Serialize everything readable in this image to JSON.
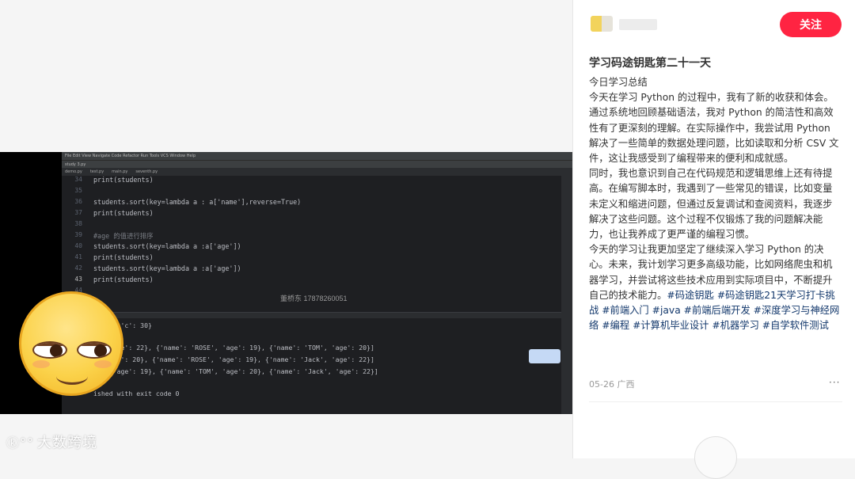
{
  "author": {
    "follow_label": "关注"
  },
  "post": {
    "title": "学习码途钥匙第二十一天",
    "paragraphs": [
      "今日学习总结",
      "今天在学习 Python 的过程中，我有了新的收获和体会。通过系统地回顾基础语法，我对 Python 的简洁性和高效性有了更深刻的理解。在实际操作中，我尝试用 Python 解决了一些简单的数据处理问题，比如读取和分析 CSV 文件，这让我感受到了编程带来的便利和成就感。",
      "同时，我也意识到自己在代码规范和逻辑思维上还有待提高。在编写脚本时，我遇到了一些常见的错误，比如变量未定义和缩进问题，但通过反复调试和查阅资料，我逐步解决了这些问题。这个过程不仅锻炼了我的问题解决能力，也让我养成了更严谨的编程习惯。"
    ],
    "last_text": "今天的学习让我更加坚定了继续深入学习 Python 的决心。未来，我计划学习更多高级功能，比如网络爬虫和机器学习，并尝试将这些技术应用到实际项目中，不断提升自己的技术能力。",
    "tags": [
      "#码途钥匙",
      "#码途钥匙21天学习打卡挑战",
      "#前端入门",
      "#java",
      "#前端后端开发",
      "#深度学习与神经网络",
      "#编程",
      "#计算机毕业设计",
      "#机器学习",
      "#自学软件测试"
    ],
    "date": "05-26",
    "location": "广西",
    "more_label": "···"
  },
  "video": {
    "logo_text": "大数跨境",
    "logo_mark": "ⓚ°°",
    "watermark": "董桥东 17878260051",
    "editor": {
      "line_numbers": [
        "34",
        "35",
        "36",
        "37",
        "38",
        "39",
        "40",
        "41",
        "42",
        "43",
        "44"
      ],
      "lines": [
        "print(students)",
        "",
        "students.sort(key=lambda a : a['name'],reverse=True)",
        "print(students)",
        "",
        "#age 的值进行排序",
        "students.sort(key=lambda a :a['age'])",
        "print(students)",
        "students.sort(key=lambda a :a['age'])",
        "print(students)",
        ""
      ]
    },
    "console": {
      "lines": [
        "': 20, 'c': 30}",
        "",
        "k', 'age': 22}, {'name': 'ROSE', 'age': 19}, {'name': 'TOM', 'age': 20}]",
        "', 'age': 20}, {'name': 'ROSE', 'age': 19}, {'name': 'Jack', 'age': 22}]",
        "SE', 'age': 19}, {'name': 'TOM', 'age': 20}, {'name': 'Jack', 'age': 22}]",
        "",
        "ished with exit code 0"
      ]
    }
  },
  "colors": {
    "accent": "#ff2442",
    "tag": "#13386c"
  }
}
